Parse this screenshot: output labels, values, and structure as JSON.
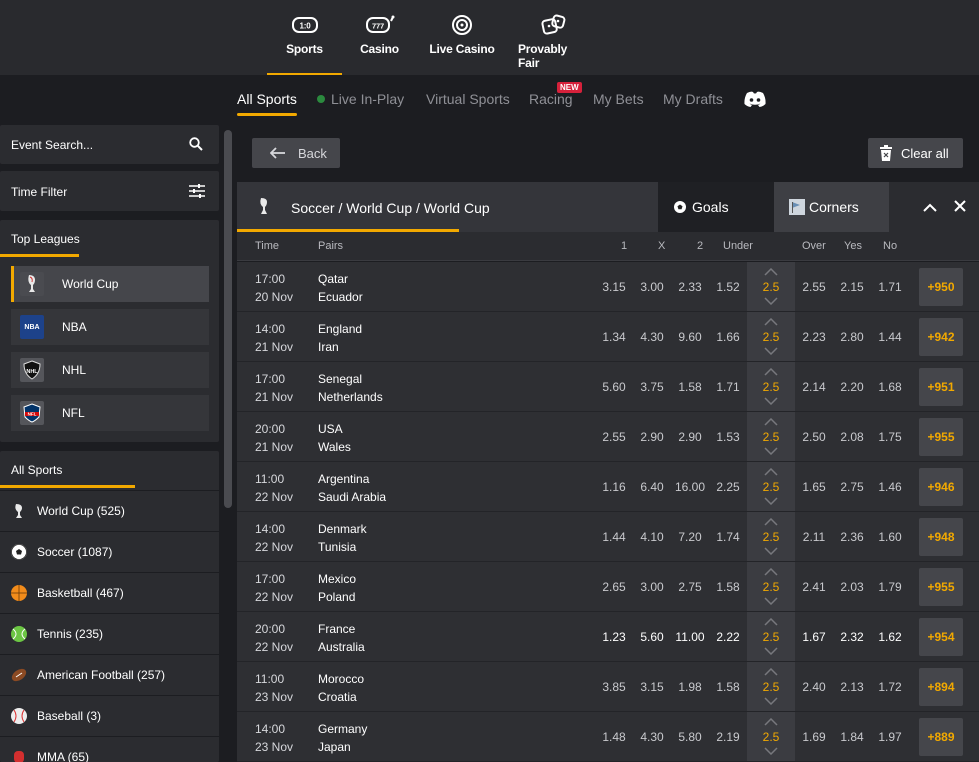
{
  "top_nav": [
    {
      "label": "Sports",
      "icon": "scoreboard-icon",
      "active": true
    },
    {
      "label": "Casino",
      "icon": "slot-machine-icon"
    },
    {
      "label": "Live Casino",
      "icon": "roulette-icon"
    },
    {
      "label": "Provably Fair",
      "icon": "dice-icon"
    }
  ],
  "sub_nav": {
    "all_sports": "All Sports",
    "live": "Live In-Play",
    "virtual": "Virtual Sports",
    "racing": "Racing",
    "racing_badge": "NEW",
    "my_bets": "My Bets",
    "my_drafts": "My Drafts",
    "discord_icon": "discord-icon"
  },
  "sidebar": {
    "search_placeholder": "Event Search...",
    "time_filter": "Time Filter",
    "top_leagues_title": "Top Leagues",
    "leagues": [
      {
        "label": "World Cup",
        "logo": "world-cup-trophy",
        "active": true
      },
      {
        "label": "NBA",
        "logo": "nba-logo"
      },
      {
        "label": "NHL",
        "logo": "nhl-logo"
      },
      {
        "label": "NFL",
        "logo": "nfl-logo"
      }
    ],
    "all_sports_title": "All Sports",
    "sports": [
      {
        "label": "World Cup (525)",
        "icon": "trophy-icon"
      },
      {
        "label": "Soccer (1087)",
        "icon": "soccer-ball-icon"
      },
      {
        "label": "Basketball (467)",
        "icon": "basketball-icon"
      },
      {
        "label": "Tennis (235)",
        "icon": "tennis-ball-icon"
      },
      {
        "label": "American Football (257)",
        "icon": "american-football-icon"
      },
      {
        "label": "Baseball (3)",
        "icon": "baseball-icon"
      },
      {
        "label": "MMA (65)",
        "icon": "boxing-glove-icon"
      }
    ]
  },
  "toolbar": {
    "back": "Back",
    "clear_all": "Clear all"
  },
  "event": {
    "path": "Soccer / World Cup / World Cup",
    "tab_goals": "Goals",
    "tab_corners": "Corners"
  },
  "columns": {
    "time": "Time",
    "pairs": "Pairs",
    "c1": "1",
    "cx": "X",
    "c2": "2",
    "under": "Under",
    "over": "Over",
    "yes": "Yes",
    "no": "No"
  },
  "matches": [
    {
      "time": "17:00",
      "date": "20 Nov",
      "home": "Qatar",
      "away": "Ecuador",
      "o1": "3.15",
      "ox": "3.00",
      "o2": "2.33",
      "under": "1.52",
      "line": "2.5",
      "over": "2.55",
      "yes": "2.15",
      "no": "1.71",
      "more": "+950"
    },
    {
      "time": "14:00",
      "date": "21 Nov",
      "home": "England",
      "away": "Iran",
      "o1": "1.34",
      "ox": "4.30",
      "o2": "9.60",
      "under": "1.66",
      "line": "2.5",
      "over": "2.23",
      "yes": "2.80",
      "no": "1.44",
      "more": "+942"
    },
    {
      "time": "17:00",
      "date": "21 Nov",
      "home": "Senegal",
      "away": "Netherlands",
      "o1": "5.60",
      "ox": "3.75",
      "o2": "1.58",
      "under": "1.71",
      "line": "2.5",
      "over": "2.14",
      "yes": "2.20",
      "no": "1.68",
      "more": "+951"
    },
    {
      "time": "20:00",
      "date": "21 Nov",
      "home": "USA",
      "away": "Wales",
      "o1": "2.55",
      "ox": "2.90",
      "o2": "2.90",
      "under": "1.53",
      "line": "2.5",
      "over": "2.50",
      "yes": "2.08",
      "no": "1.75",
      "more": "+955"
    },
    {
      "time": "11:00",
      "date": "22 Nov",
      "home": "Argentina",
      "away": "Saudi Arabia",
      "o1": "1.16",
      "ox": "6.40",
      "o2": "16.00",
      "under": "2.25",
      "line": "2.5",
      "over": "1.65",
      "yes": "2.75",
      "no": "1.46",
      "more": "+946"
    },
    {
      "time": "14:00",
      "date": "22 Nov",
      "home": "Denmark",
      "away": "Tunisia",
      "o1": "1.44",
      "ox": "4.10",
      "o2": "7.20",
      "under": "1.74",
      "line": "2.5",
      "over": "2.11",
      "yes": "2.36",
      "no": "1.60",
      "more": "+948"
    },
    {
      "time": "17:00",
      "date": "22 Nov",
      "home": "Mexico",
      "away": "Poland",
      "o1": "2.65",
      "ox": "3.00",
      "o2": "2.75",
      "under": "1.58",
      "line": "2.5",
      "over": "2.41",
      "yes": "2.03",
      "no": "1.79",
      "more": "+955"
    },
    {
      "time": "20:00",
      "date": "22 Nov",
      "home": "France",
      "away": "Australia",
      "o1": "1.23",
      "ox": "5.60",
      "o2": "11.00",
      "under": "2.22",
      "line": "2.5",
      "over": "1.67",
      "yes": "2.32",
      "no": "1.62",
      "more": "+954"
    },
    {
      "time": "11:00",
      "date": "23 Nov",
      "home": "Morocco",
      "away": "Croatia",
      "o1": "3.85",
      "ox": "3.15",
      "o2": "1.98",
      "under": "1.58",
      "line": "2.5",
      "over": "2.40",
      "yes": "2.13",
      "no": "1.72",
      "more": "+894"
    },
    {
      "time": "14:00",
      "date": "23 Nov",
      "home": "Germany",
      "away": "Japan",
      "o1": "1.48",
      "ox": "4.30",
      "o2": "5.80",
      "under": "2.19",
      "line": "2.5",
      "over": "1.69",
      "yes": "1.84",
      "no": "1.97",
      "more": "+889"
    }
  ],
  "colors": {
    "accent": "#f2a900",
    "badge": "#d6213b",
    "live_dot": "#2b8a3e",
    "bg": "#1c1d21",
    "panel": "#2b2c30"
  }
}
